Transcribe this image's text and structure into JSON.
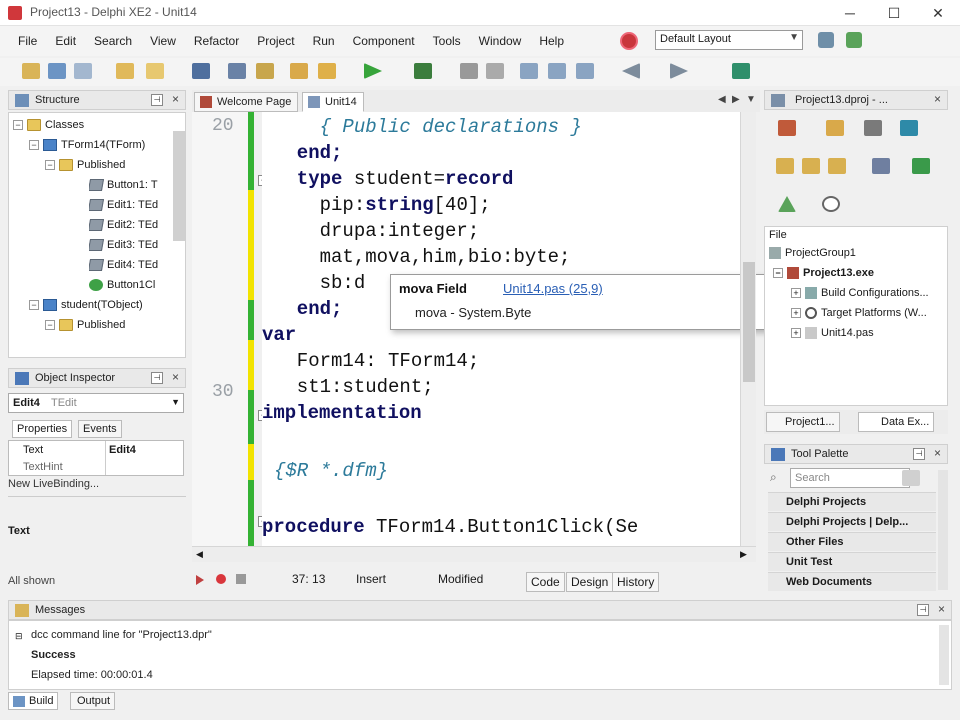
{
  "window": {
    "title": "Project13 - Delphi XE2 - Unit14"
  },
  "menu": {
    "items": [
      "File",
      "Edit",
      "Search",
      "View",
      "Refactor",
      "Project",
      "Run",
      "Component",
      "Tools",
      "Window",
      "Help"
    ],
    "layout_value": "Default Layout"
  },
  "structure": {
    "title": "Structure",
    "tree": [
      {
        "label": "Classes"
      },
      {
        "label": "TForm14(TForm)"
      },
      {
        "label": "Published"
      },
      {
        "label": "Button1: T"
      },
      {
        "label": "Edit1: TEd"
      },
      {
        "label": "Edit2: TEd"
      },
      {
        "label": "Edit3: TEd"
      },
      {
        "label": "Edit4: TEd"
      },
      {
        "label": "Button1Cl"
      },
      {
        "label": "student(TObject)"
      },
      {
        "label": "Published"
      }
    ]
  },
  "object_inspector": {
    "title": "Object Inspector",
    "selected": "Edit4",
    "selected_type": "TEdit",
    "tabs": [
      "Properties",
      "Events"
    ],
    "grid_col1": "Text",
    "grid_col2": "Edit4",
    "grid_row2": "TextHint",
    "live_binding": "New LiveBinding...",
    "desc": "Text",
    "footer": "All shown"
  },
  "editor": {
    "tabs": [
      "Welcome Page",
      "Unit14"
    ],
    "line_numbers": [
      "20",
      "30"
    ],
    "code": [
      "    { Public declarations }",
      "  end;",
      "  type student=record",
      "    pip:string[40];",
      "    drupa:integer;",
      "    mat,mova,him,bio:byte;",
      "    sb:d",
      "  end;",
      "var",
      "  Form14: TForm14;",
      "  st1:student;",
      "implementation",
      "",
      "{$R *.dfm}",
      "",
      "procedure TForm14.Button1Click(Se"
    ],
    "popup": {
      "head": "mova Field",
      "link": "Unit14.pas (25,9)",
      "item": "mova - System.Byte"
    },
    "status": {
      "position": "37: 13",
      "mode": "Insert",
      "state": "Modified",
      "tabs": [
        "Code",
        "Design",
        "History"
      ]
    }
  },
  "project_manager": {
    "title": "Project13.dproj - ...",
    "file_label": "File",
    "tree": [
      {
        "label": "ProjectGroup1"
      },
      {
        "label": "Project13.exe"
      },
      {
        "label": "Build Configurations..."
      },
      {
        "label": "Target Platforms (W..."
      },
      {
        "label": "Unit14.pas"
      }
    ],
    "tabs": [
      "Project1...",
      "Data Ex..."
    ]
  },
  "tool_palette": {
    "title": "Tool Palette",
    "search_placeholder": "Search",
    "categories": [
      "Delphi Projects",
      "Delphi Projects | Delp...",
      "Other Files",
      "Unit Test",
      "Web Documents"
    ]
  },
  "messages": {
    "title": "Messages",
    "rows": [
      "dcc command line for \"Project13.dpr\"",
      "Success",
      "Elapsed time: 00:00:01.4"
    ],
    "tabs": [
      "Build",
      "Output"
    ]
  },
  "colors": {
    "keyword": "#101060",
    "comment": "#2c7a9a",
    "change_green": "#34b233",
    "change_yellow": "#f2e300"
  }
}
